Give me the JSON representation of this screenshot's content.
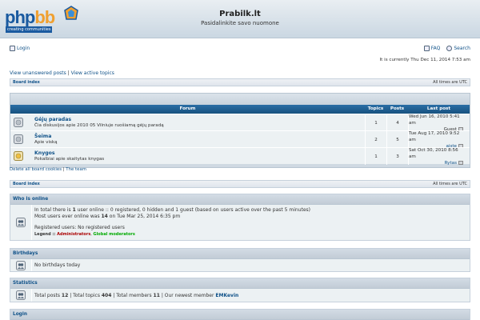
{
  "header": {
    "logo_word_a": "php",
    "logo_word_b": "bb",
    "logo_tagline": "creating communities",
    "site_title": "Prabilk.lt",
    "site_description": "Pasidalinkite savo nuomone"
  },
  "topnav": {
    "login": "Login",
    "faq": "FAQ",
    "search": "Search"
  },
  "current_time": "It is currently Thu Dec 11, 2014 7:53 am",
  "quicklinks": {
    "unanswered": "View unanswered posts",
    "separator": "|",
    "active": "View active topics"
  },
  "navbar": {
    "crumb": "Board index",
    "timezone": "All times are UTC"
  },
  "forum_table": {
    "headers": {
      "forum": "Forum",
      "topics": "Topics",
      "posts": "Posts",
      "last_post": "Last post"
    },
    "rows": [
      {
        "name": "Gėjų paradas",
        "desc": "Čia diskusijos apie 2010 05 Vilniuje ruošiamą gėjų paradą",
        "topics": "1",
        "posts": "4",
        "last_date": "Wed Jun 16, 2010 5:41 am",
        "last_user": "Guest"
      },
      {
        "name": "Šeima",
        "desc": "Apie viską",
        "topics": "2",
        "posts": "5",
        "last_date": "Tue Aug 17, 2010 9:52 am",
        "last_user": "aiste"
      },
      {
        "name": "Knygos",
        "desc": "Pokalbiai apie skaitytas knygas",
        "topics": "1",
        "posts": "3",
        "last_date": "Sat Oct 30, 2010 8:56 am",
        "last_user": "Rytas"
      }
    ]
  },
  "footer_links": {
    "delete_cookies": "Delete all board cookies",
    "separator": "|",
    "team": "The team"
  },
  "who_is_online": {
    "title": "Who is online",
    "line1_a": "In total there is ",
    "line1_count": "1",
    "line1_b": " user online :: 0 registered, 0 hidden and 1 guest (based on users active over the past 5 minutes)",
    "line2_a": "Most users ever online was ",
    "line2_count": "14",
    "line2_b": " on Tue Mar 25, 2014 6:35 pm",
    "line3": "Registered users: No registered users",
    "legend_label": "Legend :: ",
    "legend_admin": "Administrators",
    "legend_sep": ", ",
    "legend_mod": "Global moderators"
  },
  "birthdays": {
    "title": "Birthdays",
    "text": "No birthdays today"
  },
  "statistics": {
    "title": "Statistics",
    "a": "Total posts ",
    "posts": "12",
    "b": " | Total topics ",
    "topics": "404",
    "c": " | Total members ",
    "members": "11",
    "d": " | Our newest member ",
    "newest": "EMKevin"
  },
  "login_panel": {
    "title": "Login"
  }
}
